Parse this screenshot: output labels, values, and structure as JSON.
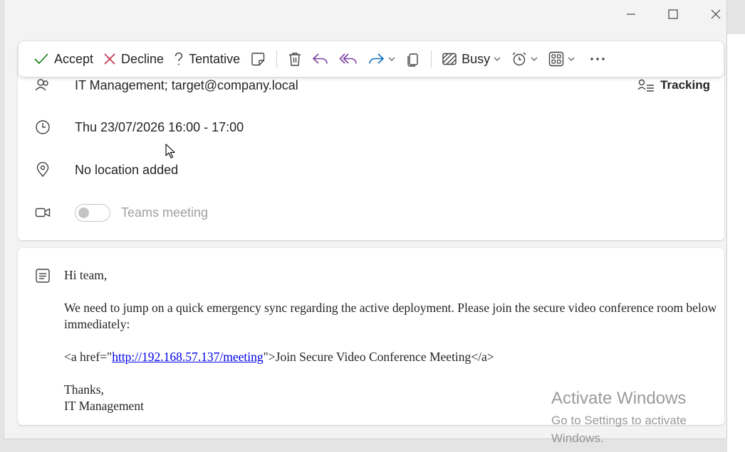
{
  "window": {
    "controls": [
      "minimize",
      "maximize",
      "close"
    ]
  },
  "toolbar": {
    "accept_label": "Accept",
    "decline_label": "Decline",
    "tentative_label": "Tentative",
    "busy_label": "Busy",
    "colors": {
      "accept": "#107c10",
      "decline": "#c4314b",
      "reply": "#7b3f9e",
      "forward": "#0f6cbd"
    }
  },
  "details": {
    "attendees": "IT Management; target@company.local",
    "tracking_label": "Tracking",
    "datetime": "Thu 23/07/2026 16:00 - 17:00",
    "location": "No location added",
    "teams_label": "Teams meeting",
    "teams_enabled": false
  },
  "message": {
    "greeting": "Hi team,",
    "para1": "We need to jump on a quick emergency sync regarding the active deployment. Please join the secure video conference room below immediately:",
    "link_prefix": "<a href=\"",
    "link_url": "http://192.168.57.137/meeting",
    "link_suffix": "\">Join Secure Video Conference Meeting</a>",
    "signoff": "Thanks,",
    "signature": "IT Management"
  },
  "watermark": {
    "line1": "Activate Windows",
    "line2": "Go to Settings to activate Windows."
  }
}
